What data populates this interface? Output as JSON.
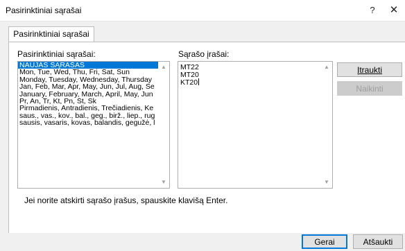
{
  "window": {
    "title": "Pasirinktiniai sąrašai",
    "help_glyph": "?",
    "close_glyph": "✕"
  },
  "tab": {
    "label": "Pasirinktiniai sąrašai"
  },
  "lists_panel": {
    "label": "Pasirinktiniai sąrašai:",
    "items": [
      "NAUJAS SĄRAŠAS",
      "Mon, Tue, Wed, Thu, Fri, Sat, Sun",
      "Monday, Tuesday, Wednesday, Thursday",
      "Jan, Feb, Mar, Apr, May, Jun, Jul, Aug, Se",
      "January, February, March, April, May, Jun",
      "Pr, An, Tr, Kt, Pn, Št, Sk",
      "Pirmadienis, Antradienis, Trečiadienis, Ke",
      "saus., vas., kov., bal., geg., birž., liep., rug",
      "sausis, vasaris, kovas, balandis, gegužė, l"
    ],
    "selected_index": 0
  },
  "entries_panel": {
    "label": "Sąrašo įrašai:",
    "lines": [
      "MT22",
      "MT20",
      "KT20"
    ]
  },
  "buttons": {
    "insert_label": "Įtraukti",
    "delete_label": "Naikinti",
    "ok_label": "Gerai",
    "cancel_label": "Atšaukti"
  },
  "hint": "Jei norite atskirti sąrašo įrašus, spauskite klavišą Enter.",
  "icons": {
    "scroll_up": "▲",
    "scroll_down": "▼"
  }
}
